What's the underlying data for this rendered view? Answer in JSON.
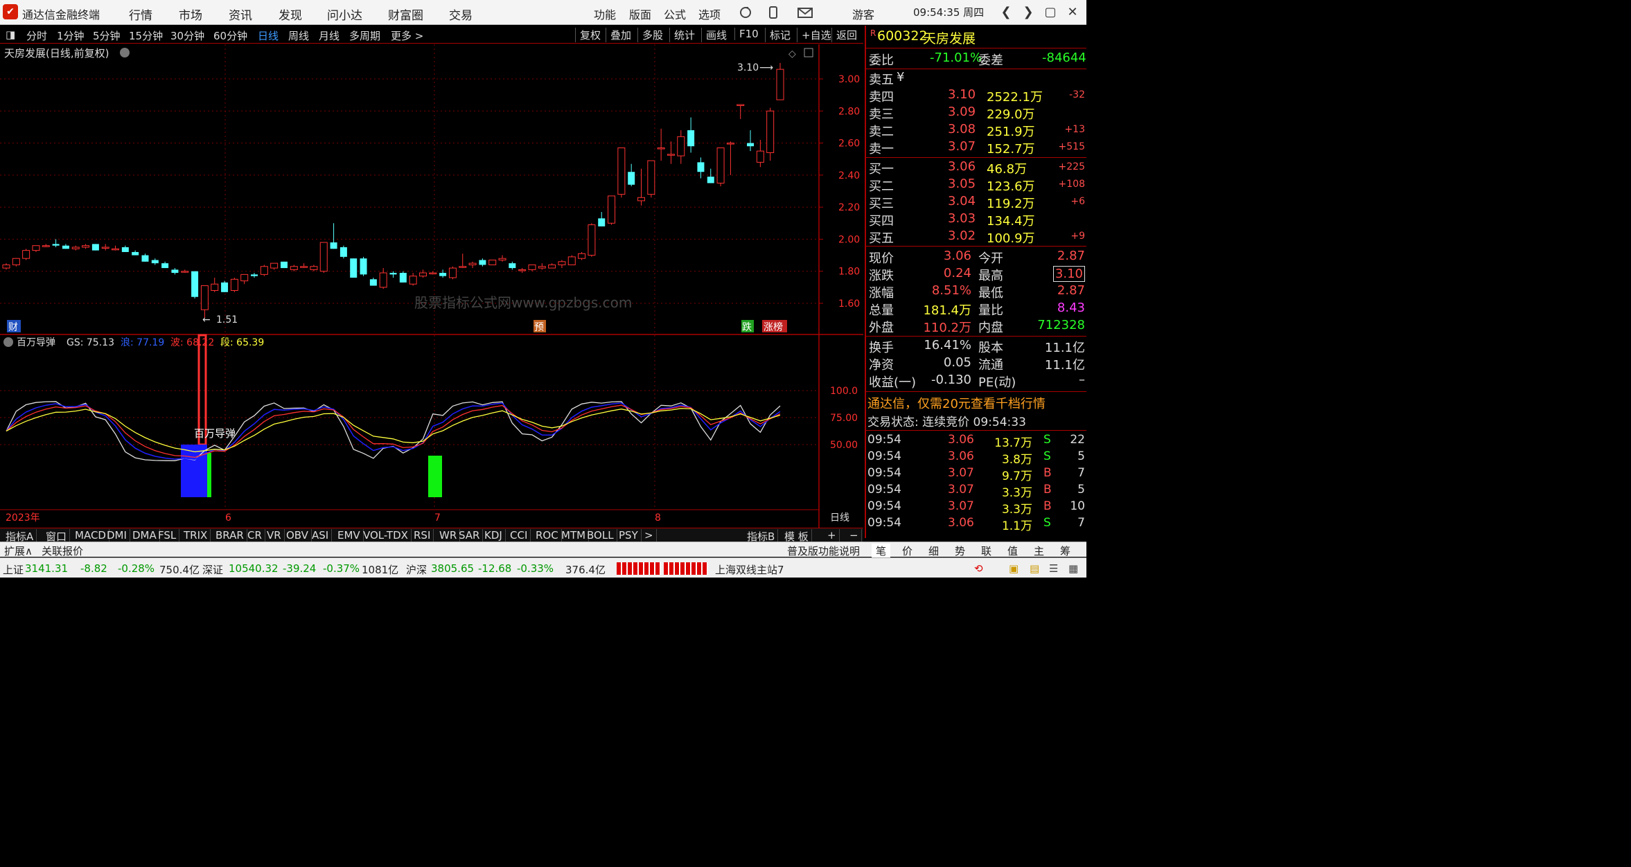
{
  "app": {
    "title": "通达信金融终端",
    "logo_glyph": "✔",
    "user": "游客",
    "time": "09:54:35 周四"
  },
  "main_menu": [
    "行情",
    "市场",
    "资讯",
    "发现",
    "问小达",
    "财富圈",
    "交易"
  ],
  "right_menu": [
    "功能",
    "版面",
    "公式",
    "选项"
  ],
  "toolbar": {
    "periods": [
      "分时",
      "1分钟",
      "5分钟",
      "15分钟",
      "30分钟",
      "60分钟",
      "日线",
      "周线",
      "月线",
      "多周期",
      "更多 >"
    ],
    "active_period": "日线",
    "actions": [
      "复权",
      "叠加",
      "多股",
      "统计",
      "画线",
      "F10",
      "标记",
      "+自选",
      "返回"
    ]
  },
  "chart": {
    "title": "天房发展(日线,前复权)",
    "price_axis": [
      "3.00",
      "2.80",
      "2.60",
      "2.40",
      "2.20",
      "2.00",
      "1.80",
      "1.60"
    ],
    "high_label": "3.10",
    "low_label": "1.51",
    "watermark": "股票指标公式网www.gpzbgs.com",
    "markers": {
      "cai": "财",
      "yu": "预",
      "die": "跌",
      "zhangbang": "涨榜"
    },
    "indicator": {
      "name": "百万导弹",
      "gs": "GS: 75.13",
      "lang": "浪: 77.19",
      "bo": "波: 68.22",
      "duan": "段: 65.39",
      "label": "百万导弹"
    },
    "ind_axis": [
      "100.0",
      "75.00",
      "50.00"
    ],
    "date_labels": [
      "2023年",
      "6",
      "7",
      "8"
    ],
    "period_label": "日线"
  },
  "indicator_tabs": [
    "指标A",
    "窗口",
    "MACD",
    "DMI",
    "DMA",
    "FSL",
    "TRIX",
    "BRAR",
    "CR",
    "VR",
    "OBV",
    "ASI",
    "EMV",
    "VOL-TDX",
    "RSI",
    "WR",
    "SAR",
    "KDJ",
    "CCI",
    "ROC",
    "MTM",
    "BOLL",
    "PSY",
    ">"
  ],
  "indicator_tabs_right": [
    "指标B",
    "模 板",
    "+",
    "−"
  ],
  "ext_bar": {
    "expand": "扩展∧",
    "related": "关联报价",
    "tip": "普及版功能说明",
    "tabs": [
      "笔",
      "价",
      "细",
      "势",
      "联",
      "值",
      "主",
      "筹"
    ]
  },
  "quote": {
    "marker": "R",
    "code": "600322",
    "name": "天房发展",
    "weibi_label": "委比",
    "weibi": "-71.01%",
    "weicha_label": "委差",
    "weicha": "-84644",
    "sell5_label": "卖五",
    "sell5_sym": "¥",
    "asks": [
      {
        "label": "卖四",
        "price": "3.10",
        "vol": "2522.1万",
        "chg": "-32"
      },
      {
        "label": "卖三",
        "price": "3.09",
        "vol": "229.0万",
        "chg": ""
      },
      {
        "label": "卖二",
        "price": "3.08",
        "vol": "251.9万",
        "chg": "+13"
      },
      {
        "label": "卖一",
        "price": "3.07",
        "vol": "152.7万",
        "chg": "+515"
      }
    ],
    "bids": [
      {
        "label": "买一",
        "price": "3.06",
        "vol": "46.8万",
        "chg": "+225"
      },
      {
        "label": "买二",
        "price": "3.05",
        "vol": "123.6万",
        "chg": "+108"
      },
      {
        "label": "买三",
        "price": "3.04",
        "vol": "119.2万",
        "chg": "+6"
      },
      {
        "label": "买四",
        "price": "3.03",
        "vol": "134.4万",
        "chg": ""
      },
      {
        "label": "买五",
        "price": "3.02",
        "vol": "100.9万",
        "chg": "+9"
      }
    ],
    "stats": [
      {
        "l1": "现价",
        "v1": "3.06",
        "l2": "今开",
        "v2": "2.87"
      },
      {
        "l1": "涨跌",
        "v1": "0.24",
        "l2": "最高",
        "v2": "3.10"
      },
      {
        "l1": "涨幅",
        "v1": "8.51%",
        "l2": "最低",
        "v2": "2.87"
      },
      {
        "l1": "总量",
        "v1": "181.4万",
        "l2": "量比",
        "v2": "8.43"
      },
      {
        "l1": "外盘",
        "v1": "110.2万",
        "l2": "内盘",
        "v2": "712328"
      }
    ],
    "stats2": [
      {
        "l1": "换手",
        "v1": "16.41%",
        "l2": "股本",
        "v2": "11.1亿"
      },
      {
        "l1": "净资",
        "v1": "0.05",
        "l2": "流通",
        "v2": "11.1亿"
      },
      {
        "l1": "收益(一)",
        "v1": "-0.130",
        "l2": "PE(动)",
        "v2": "–"
      }
    ],
    "promo": "通达信，仅需20元查看千档行情",
    "trade_state": "交易状态: 连续竞价 09:54:33",
    "ticks": [
      {
        "t": "09:54",
        "p": "3.06",
        "v": "13.7万",
        "s": "S",
        "n": "22"
      },
      {
        "t": "09:54",
        "p": "3.06",
        "v": "3.8万",
        "s": "S",
        "n": "5"
      },
      {
        "t": "09:54",
        "p": "3.07",
        "v": "9.7万",
        "s": "B",
        "n": "7"
      },
      {
        "t": "09:54",
        "p": "3.07",
        "v": "3.3万",
        "s": "B",
        "n": "5"
      },
      {
        "t": "09:54",
        "p": "3.07",
        "v": "3.3万",
        "s": "B",
        "n": "10"
      },
      {
        "t": "09:54",
        "p": "3.06",
        "v": "1.1万",
        "s": "S",
        "n": "7"
      }
    ]
  },
  "status": {
    "sh_label": "上证",
    "sh_val": "3141.31",
    "sh_chg": "-8.82",
    "sh_pct": "-0.28%",
    "sh_amt": "750.4亿",
    "sz_label": "深证",
    "sz_val": "10540.32",
    "sz_chg": "-39.24",
    "sz_pct": "-0.37%",
    "sz_amt": "1081亿",
    "hs_label": "沪深",
    "hs_val": "3805.65",
    "hs_chg": "-12.68",
    "hs_pct": "-0.33%",
    "hs_amt": "376.4亿",
    "server": "上海双线主站7"
  },
  "chart_data": {
    "type": "candlestick",
    "candles": [
      {
        "o": 1.82,
        "h": 1.85,
        "l": 1.81,
        "c": 1.84
      },
      {
        "o": 1.84,
        "h": 1.88,
        "l": 1.83,
        "c": 1.88
      },
      {
        "o": 1.88,
        "h": 1.94,
        "l": 1.87,
        "c": 1.93
      },
      {
        "o": 1.93,
        "h": 1.96,
        "l": 1.92,
        "c": 1.96
      },
      {
        "o": 1.96,
        "h": 1.97,
        "l": 1.95,
        "c": 1.96
      },
      {
        "o": 1.97,
        "h": 2.0,
        "l": 1.95,
        "c": 1.96
      },
      {
        "o": 1.96,
        "h": 1.97,
        "l": 1.94,
        "c": 1.94
      },
      {
        "o": 1.94,
        "h": 1.96,
        "l": 1.93,
        "c": 1.95
      },
      {
        "o": 1.95,
        "h": 1.97,
        "l": 1.94,
        "c": 1.96
      },
      {
        "o": 1.97,
        "h": 1.97,
        "l": 1.93,
        "c": 1.93
      },
      {
        "o": 1.95,
        "h": 1.97,
        "l": 1.93,
        "c": 1.95
      },
      {
        "o": 1.94,
        "h": 1.96,
        "l": 1.93,
        "c": 1.94
      },
      {
        "o": 1.95,
        "h": 1.96,
        "l": 1.92,
        "c": 1.92
      },
      {
        "o": 1.92,
        "h": 1.93,
        "l": 1.9,
        "c": 1.9
      },
      {
        "o": 1.9,
        "h": 1.91,
        "l": 1.86,
        "c": 1.86
      },
      {
        "o": 1.87,
        "h": 1.88,
        "l": 1.84,
        "c": 1.85
      },
      {
        "o": 1.85,
        "h": 1.86,
        "l": 1.82,
        "c": 1.82
      },
      {
        "o": 1.81,
        "h": 1.82,
        "l": 1.78,
        "c": 1.79
      },
      {
        "o": 1.8,
        "h": 1.81,
        "l": 1.79,
        "c": 1.8
      },
      {
        "o": 1.8,
        "h": 1.8,
        "l": 1.63,
        "c": 1.64
      },
      {
        "o": 1.56,
        "h": 1.71,
        "l": 1.51,
        "c": 1.71
      },
      {
        "o": 1.68,
        "h": 1.76,
        "l": 1.67,
        "c": 1.72
      },
      {
        "o": 1.73,
        "h": 1.74,
        "l": 1.67,
        "c": 1.67
      },
      {
        "o": 1.68,
        "h": 1.76,
        "l": 1.67,
        "c": 1.75
      },
      {
        "o": 1.74,
        "h": 1.78,
        "l": 1.72,
        "c": 1.78
      },
      {
        "o": 1.78,
        "h": 1.79,
        "l": 1.76,
        "c": 1.77
      },
      {
        "o": 1.78,
        "h": 1.84,
        "l": 1.77,
        "c": 1.83
      },
      {
        "o": 1.82,
        "h": 1.85,
        "l": 1.81,
        "c": 1.85
      },
      {
        "o": 1.86,
        "h": 1.86,
        "l": 1.82,
        "c": 1.82
      },
      {
        "o": 1.81,
        "h": 1.84,
        "l": 1.8,
        "c": 1.83
      },
      {
        "o": 1.83,
        "h": 1.85,
        "l": 1.82,
        "c": 1.83
      },
      {
        "o": 1.81,
        "h": 1.84,
        "l": 1.8,
        "c": 1.83
      },
      {
        "o": 1.8,
        "h": 1.98,
        "l": 1.79,
        "c": 1.98
      },
      {
        "o": 1.98,
        "h": 2.1,
        "l": 1.94,
        "c": 1.94
      },
      {
        "o": 1.95,
        "h": 1.96,
        "l": 1.88,
        "c": 1.89
      },
      {
        "o": 1.88,
        "h": 1.88,
        "l": 1.76,
        "c": 1.76
      },
      {
        "o": 1.88,
        "h": 1.89,
        "l": 1.77,
        "c": 1.78
      },
      {
        "o": 1.75,
        "h": 1.76,
        "l": 1.71,
        "c": 1.71
      },
      {
        "o": 1.7,
        "h": 1.82,
        "l": 1.69,
        "c": 1.79
      },
      {
        "o": 1.79,
        "h": 1.8,
        "l": 1.76,
        "c": 1.78
      },
      {
        "o": 1.79,
        "h": 1.8,
        "l": 1.73,
        "c": 1.73
      },
      {
        "o": 1.72,
        "h": 1.79,
        "l": 1.71,
        "c": 1.77
      },
      {
        "o": 1.77,
        "h": 1.81,
        "l": 1.76,
        "c": 1.79
      },
      {
        "o": 1.79,
        "h": 1.8,
        "l": 1.78,
        "c": 1.79
      },
      {
        "o": 1.79,
        "h": 1.81,
        "l": 1.76,
        "c": 1.77
      },
      {
        "o": 1.76,
        "h": 1.83,
        "l": 1.75,
        "c": 1.82
      },
      {
        "o": 1.83,
        "h": 1.91,
        "l": 1.82,
        "c": 1.83
      },
      {
        "o": 1.84,
        "h": 1.86,
        "l": 1.82,
        "c": 1.85
      },
      {
        "o": 1.87,
        "h": 1.88,
        "l": 1.83,
        "c": 1.84
      },
      {
        "o": 1.84,
        "h": 1.87,
        "l": 1.84,
        "c": 1.87
      },
      {
        "o": 1.87,
        "h": 1.9,
        "l": 1.86,
        "c": 1.88
      },
      {
        "o": 1.85,
        "h": 1.86,
        "l": 1.81,
        "c": 1.82
      },
      {
        "o": 1.81,
        "h": 1.82,
        "l": 1.79,
        "c": 1.81
      },
      {
        "o": 1.81,
        "h": 1.84,
        "l": 1.8,
        "c": 1.84
      },
      {
        "o": 1.82,
        "h": 1.85,
        "l": 1.81,
        "c": 1.83
      },
      {
        "o": 1.82,
        "h": 1.85,
        "l": 1.82,
        "c": 1.84
      },
      {
        "o": 1.84,
        "h": 1.87,
        "l": 1.82,
        "c": 1.86
      },
      {
        "o": 1.84,
        "h": 1.9,
        "l": 1.84,
        "c": 1.89
      },
      {
        "o": 1.88,
        "h": 1.92,
        "l": 1.87,
        "c": 1.91
      },
      {
        "o": 1.9,
        "h": 2.1,
        "l": 1.89,
        "c": 2.09
      },
      {
        "o": 2.13,
        "h": 2.17,
        "l": 2.08,
        "c": 2.08
      },
      {
        "o": 2.1,
        "h": 2.27,
        "l": 2.09,
        "c": 2.27
      },
      {
        "o": 2.28,
        "h": 2.57,
        "l": 2.26,
        "c": 2.57
      },
      {
        "o": 2.42,
        "h": 2.47,
        "l": 2.33,
        "c": 2.34
      },
      {
        "o": 2.24,
        "h": 2.44,
        "l": 2.21,
        "c": 2.26
      },
      {
        "o": 2.28,
        "h": 2.49,
        "l": 2.26,
        "c": 2.49
      },
      {
        "o": 2.57,
        "h": 2.69,
        "l": 2.49,
        "c": 2.57
      },
      {
        "o": 2.53,
        "h": 2.61,
        "l": 2.47,
        "c": 2.53
      },
      {
        "o": 2.52,
        "h": 2.68,
        "l": 2.47,
        "c": 2.64
      },
      {
        "o": 2.68,
        "h": 2.76,
        "l": 2.54,
        "c": 2.58
      },
      {
        "o": 2.48,
        "h": 2.51,
        "l": 2.38,
        "c": 2.42
      },
      {
        "o": 2.39,
        "h": 2.44,
        "l": 2.35,
        "c": 2.35
      },
      {
        "o": 2.35,
        "h": 2.57,
        "l": 2.33,
        "c": 2.57
      },
      {
        "o": 2.6,
        "h": 2.61,
        "l": 2.4,
        "c": 2.6
      },
      {
        "o": 2.84,
        "h": 2.84,
        "l": 2.75,
        "c": 2.84
      },
      {
        "o": 2.6,
        "h": 2.68,
        "l": 2.55,
        "c": 2.58
      },
      {
        "o": 2.48,
        "h": 2.62,
        "l": 2.45,
        "c": 2.55
      },
      {
        "o": 2.54,
        "h": 2.82,
        "l": 2.49,
        "c": 2.8
      },
      {
        "o": 2.87,
        "h": 3.1,
        "l": 2.87,
        "c": 3.06
      }
    ]
  }
}
